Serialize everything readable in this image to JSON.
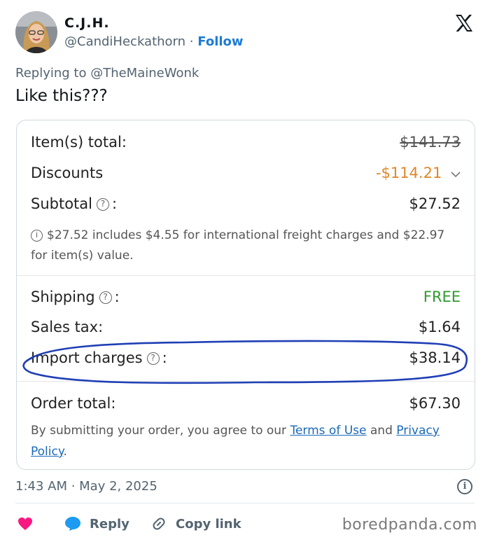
{
  "author": {
    "name": "C.J.H.",
    "handle": "@CandiHeckathorn",
    "separator": "·",
    "follow_label": "Follow",
    "avatar_icon": "profile-photo"
  },
  "platform_icon": "x-logo-icon",
  "replying_to": "Replying to @TheMaineWonk",
  "text": "Like this???",
  "receipt": {
    "items_total_label": "Item(s) total:",
    "items_total_value": "$141.73",
    "discounts_label": "Discounts",
    "discounts_value": "-$114.21",
    "subtotal_label": "Subtotal",
    "subtotal_value": "$27.52",
    "note": "$27.52 includes $4.55 for international freight charges and $22.97 for item(s) value.",
    "shipping_label": "Shipping",
    "shipping_value": "FREE",
    "sales_tax_label": "Sales tax:",
    "sales_tax_value": "$1.64",
    "import_label": "Import charges",
    "import_value": "$38.14",
    "order_total_label": "Order total:",
    "order_total_value": "$67.30",
    "legal_prefix": "By submitting your order, you agree to our",
    "terms_link": "Terms of Use",
    "legal_and": "and",
    "privacy_link": "Privacy Policy",
    "legal_suffix": ".",
    "colors": {
      "discount": "#e0862a",
      "free": "#2f9a2f",
      "link": "#1a69b8",
      "annotation": "#1f3fb5"
    }
  },
  "timestamp": "1:43 AM · May 2, 2025",
  "actions": {
    "reply_label": "Reply",
    "copy_link_label": "Copy link"
  },
  "watermark": "boredpanda.com"
}
